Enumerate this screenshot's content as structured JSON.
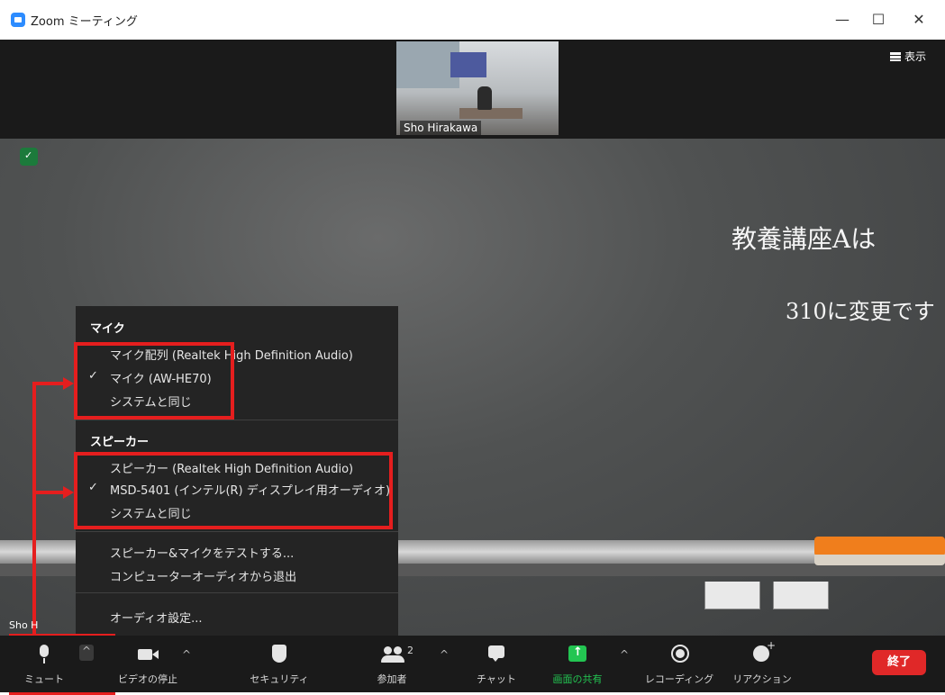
{
  "window": {
    "title": "Zoom ミーティング",
    "minimize": "—",
    "maximize": "☐",
    "close": "✕"
  },
  "top_strip": {
    "participant_name": "Sho Hirakawa",
    "view_label": "表示"
  },
  "board_text": {
    "line1": "教養講座Aは",
    "line2": "310に変更です"
  },
  "audio_menu": {
    "mic_header": "マイク",
    "mic_items": [
      {
        "label": "マイク配列 (Realtek High Definition Audio)",
        "checked": false
      },
      {
        "label": "マイク (AW-HE70)",
        "checked": true
      },
      {
        "label": "システムと同じ",
        "checked": false
      }
    ],
    "speaker_header": "スピーカー",
    "speaker_items": [
      {
        "label": "スピーカー (Realtek High Definition Audio)",
        "checked": false
      },
      {
        "label": "MSD-5401 (インテル(R) ディスプレイ用オーディオ)",
        "checked": true
      },
      {
        "label": "システムと同じ",
        "checked": false
      }
    ],
    "test_label": "スピーカー&マイクをテストする...",
    "leave_label": "コンピューターオーディオから退出",
    "settings_label": "オーディオ設定...",
    "check_mark": "✓"
  },
  "self_label": "Sho H",
  "toolbar": {
    "mute": "ミュート",
    "stop_video": "ビデオの停止",
    "security": "セキュリティ",
    "participants": "参加者",
    "participant_count": "2",
    "chat": "チャット",
    "share_screen": "画面の共有",
    "recording": "レコーディング",
    "reactions": "リアクション",
    "end": "終了",
    "caret": "^"
  },
  "colors": {
    "accent_red": "#e51e1e",
    "share_green": "#23c552",
    "end_red": "#e02828"
  }
}
